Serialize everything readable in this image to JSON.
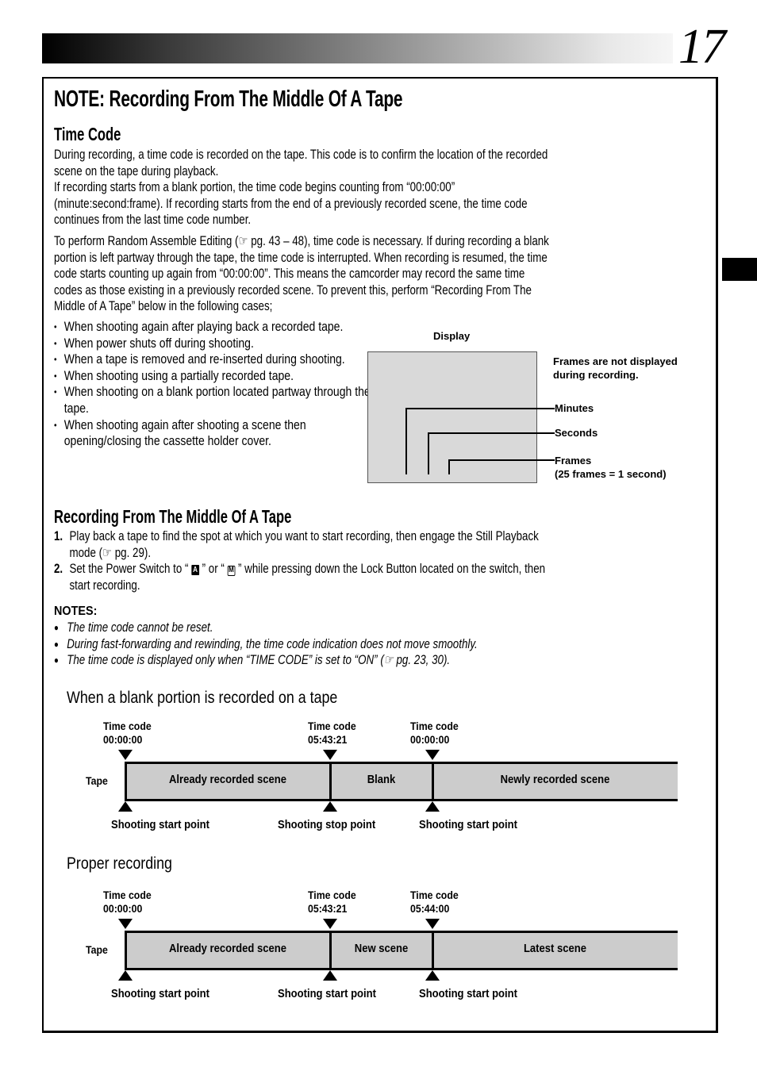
{
  "page": {
    "number": "17",
    "title": "NOTE: Recording From The Middle Of A Tape"
  },
  "time_code": {
    "heading": "Time Code",
    "para1_line1": "During recording, a time code is recorded on the tape. This code is to confirm the location of the recorded",
    "para1_line2": "scene on the tape during playback.",
    "para1_line3": "If recording starts from a blank portion, the time code begins counting from “00:00:00”",
    "para1_line4": "(minute:second:frame). If recording starts from the end of a previously recorded scene, the time code",
    "para1_line5": "continues from the last time code number.",
    "para2_line1_pre": "To perform Random Assemble Editing (",
    "ref_icon": "☞",
    "para2_line1_post": " pg. 43 – 48), time code is necessary. If during recording a blank",
    "para2_line2": "portion is left partway through the tape, the time code is interrupted. When recording is resumed, the time",
    "para2_line3": "code starts counting up again from “00:00:00”. This means the camcorder may record the same time",
    "para2_line4": "codes as those existing in a previously recorded scene. To prevent this, perform “Recording From The",
    "para2_line5": "Middle of A Tape” below in the following cases;",
    "bullet_glyph": "•",
    "cases": [
      "When shooting again after playing back a recorded tape.",
      "When power shuts off during shooting.",
      "When a tape is removed and re-inserted during shooting.",
      "When shooting using a partially recorded tape.",
      "When shooting on a blank portion located partway through the tape.",
      "When shooting again after shooting a scene then opening/closing the cassette holder cover."
    ]
  },
  "display_diagram": {
    "title": "Display",
    "note_line1": "Frames are not displayed",
    "note_line2": "during recording.",
    "minutes": "Minutes",
    "seconds": "Seconds",
    "frames": "Frames",
    "frames_note": "(25 frames = 1 second)"
  },
  "procedure": {
    "heading": "Recording From The Middle Of A Tape",
    "steps": [
      {
        "num": "1.",
        "line1": "Play back a tape to find the spot at which you want to start recording, then engage the Still Playback",
        "line2_pre": "mode (",
        "line2_post": " pg. 29)."
      },
      {
        "num": "2.",
        "line1_a": "Set the Power Switch to “ ",
        "icon_a": "A",
        "line1_b": " ” or “ ",
        "icon_m": "M",
        "line1_c": " ” while pressing down the Lock Button located on the switch, then",
        "line2": "start recording."
      }
    ]
  },
  "notes": {
    "title": "NOTES:",
    "bullet_glyph": "●",
    "items": [
      "The time code cannot be reset.",
      "During fast-forwarding and rewinding, the time code indication does not move smoothly."
    ],
    "item3_pre": "The time code is displayed only when “TIME CODE” is set to “ON” (",
    "item3_post": " pg. 23, 30)."
  },
  "diagram_blank": {
    "title": "When a blank portion is recorded on a tape",
    "tape_label": "Tape",
    "time_codes": [
      {
        "label": "Time code",
        "value": "00:00:00"
      },
      {
        "label": "Time code",
        "value": "05:43:21"
      },
      {
        "label": "Time code",
        "value": "00:00:00"
      }
    ],
    "segments": [
      "Already recorded scene",
      "Blank",
      "Newly recorded scene"
    ],
    "points": [
      "Shooting start point",
      "Shooting stop point",
      "Shooting start point"
    ]
  },
  "diagram_proper": {
    "title": "Proper recording",
    "tape_label": "Tape",
    "time_codes": [
      {
        "label": "Time code",
        "value": "00:00:00"
      },
      {
        "label": "Time code",
        "value": "05:43:21"
      },
      {
        "label": "Time code",
        "value": "05:44:00"
      }
    ],
    "segments": [
      "Already recorded scene",
      "New scene",
      "Latest scene"
    ],
    "points": [
      "Shooting start point",
      "Shooting start point",
      "Shooting start point"
    ]
  }
}
